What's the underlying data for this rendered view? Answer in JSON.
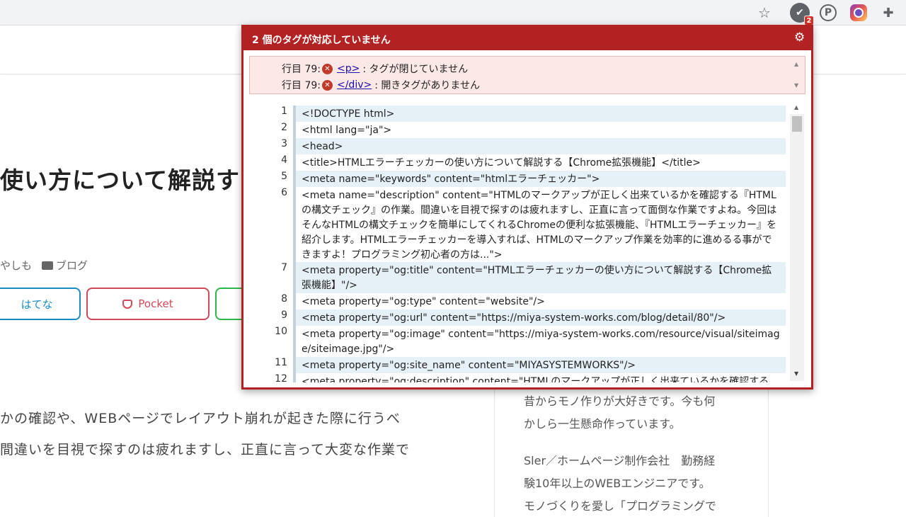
{
  "toolbar": {
    "star_icon": "star-icon",
    "extension_badge": "2",
    "pinterest_glyph": "P",
    "icons": [
      "star-icon",
      "html-checker-icon",
      "pinterest-icon",
      "instagram-icon",
      "puzzle-icon"
    ]
  },
  "page": {
    "article_title": "使い方について解説す",
    "author_fragment": "やしも",
    "category": "ブログ",
    "share": {
      "hatena": "はてな",
      "pocket": "Pocket"
    },
    "body_lines": [
      "かの確認や、WEBページでレイアウト崩れが起きた際に行うべ",
      "間違いを目視で探すのは疲れますし、正直に言って大変な作業で"
    ],
    "sidebar_lines": [
      "昔からモノ作りが大好きです。今も何",
      "かしら一生懸命作っています。",
      "Sler／ホームページ制作会社　勤務経",
      "験10年以上のWEBエンジニアです。",
      "モノづくりを愛し「プログラミングで"
    ]
  },
  "popup": {
    "title": "2 個のタグが対応していません",
    "errors": [
      {
        "line": "行目 79:",
        "tag": "<p>",
        "message": ": タグが閉じていません"
      },
      {
        "line": "行目 79:",
        "tag": "</div>",
        "message": ": 開きタグがありません"
      }
    ],
    "code": [
      {
        "n": "1",
        "text": "<!DOCTYPE html>"
      },
      {
        "n": "2",
        "text": "<html lang=\"ja\">"
      },
      {
        "n": "3",
        "text": "<head>"
      },
      {
        "n": "4",
        "text": "<title>HTMLエラーチェッカーの使い方について解説する【Chrome拡張機能】</title>"
      },
      {
        "n": "5",
        "text": "<meta name=\"keywords\" content=\"htmlエラーチェッカー\">"
      },
      {
        "n": "6",
        "text": "<meta name=\"description\" content=\"HTMLのマークアップが正しく出来ているかを確認する『HTMLの構文チェック』の作業。間違いを目視で探すのは疲れますし、正直に言って面倒な作業ですよね。今回はそんなHTMLの構文チェックを簡単にしてくれるChromeの便利な拡張機能、『HTMLエラーチェッカー』を紹介します。HTMLエラーチェッカーを導入すれば、HTMLのマークアップ作業を効率的に進めるる事ができますよ！プログラミング初心者の方は...\">"
      },
      {
        "n": "7",
        "text": "<meta property=\"og:title\" content=\"HTMLエラーチェッカーの使い方について解説する【Chrome拡張機能】\"/>"
      },
      {
        "n": "8",
        "text": "<meta property=\"og:type\" content=\"website\"/>"
      },
      {
        "n": "9",
        "text": "<meta property=\"og:url\" content=\"https://miya-system-works.com/blog/detail/80\"/>"
      },
      {
        "n": "10",
        "text": "<meta property=\"og:image\" content=\"https://miya-system-works.com/resource/visual/siteimage/siteimage.jpg\"/>"
      },
      {
        "n": "11",
        "text": "<meta property=\"og:site_name\" content=\"MIYASYSTEMWORKS\"/>"
      },
      {
        "n": "12",
        "text": "<meta property=\"og:description\" content=\"HTMLのマークアップが正しく出来ているかを確認する"
      }
    ]
  }
}
